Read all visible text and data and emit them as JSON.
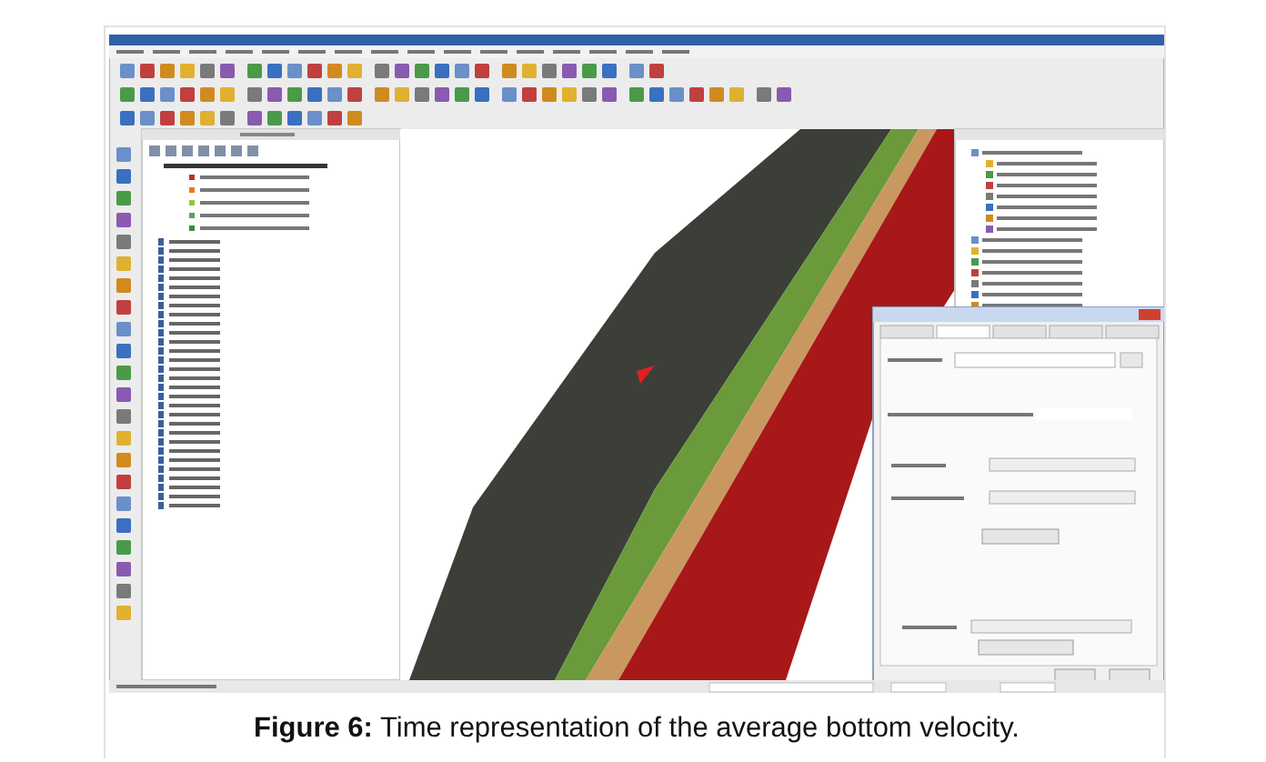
{
  "figure": {
    "caption": "**Figure 6:** Time representation of the average bottom velocity."
  }
}
